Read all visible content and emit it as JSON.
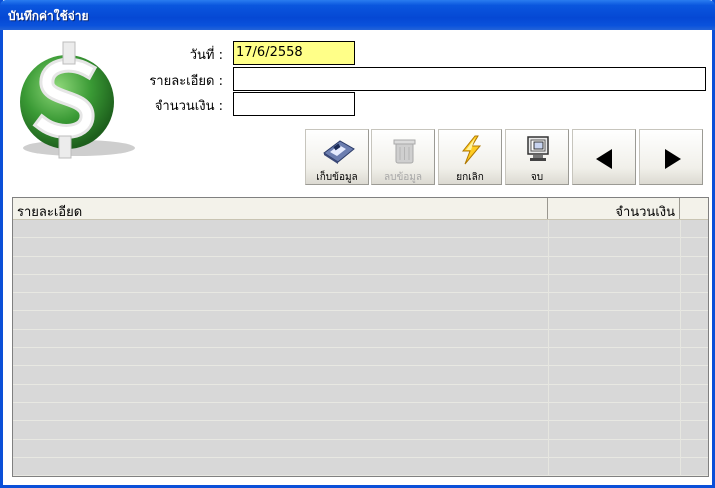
{
  "window": {
    "title": "บันทึกค่าใช้จ่าย",
    "title_color": "#0a56de"
  },
  "form": {
    "date_label": "วันที่ :",
    "date_value": "17/6/2558",
    "detail_label": "รายละเอียด :",
    "detail_value": "",
    "amount_label": "จำนวนเงิน :",
    "amount_value": ""
  },
  "toolbar": {
    "save_label": "เก็บข้อมูล",
    "delete_label": "ลบข้อมูล",
    "cancel_label": "ยกเลิก",
    "exit_label": "จบ",
    "prev_icon": "left-arrow-icon",
    "next_icon": "right-arrow-icon"
  },
  "grid": {
    "columns": [
      "รายละเอียด",
      "จำนวนเงิน"
    ],
    "rows": []
  },
  "colors": {
    "date_field": "#ffff88",
    "logo_green": "#2f8d2f"
  }
}
